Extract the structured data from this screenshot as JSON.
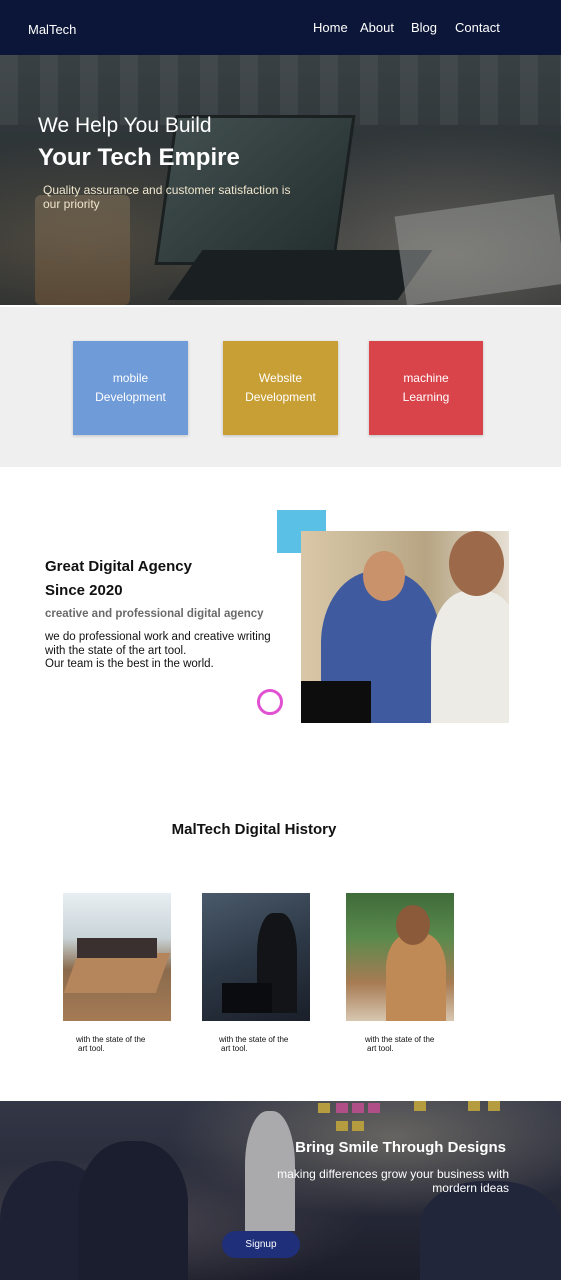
{
  "nav": {
    "brand": "MalTech",
    "links": [
      "Home",
      "About",
      "Blog",
      "Contact"
    ]
  },
  "hero": {
    "line1": "We Help You Build",
    "line2": "Your Tech Empire",
    "subtitle": "Quality assurance and customer satisfaction is our priority"
  },
  "services": [
    {
      "line1": "mobile",
      "line2": "Development",
      "color": "#6f9bd8"
    },
    {
      "line1": "Website",
      "line2": "Development",
      "color": "#c89f34"
    },
    {
      "line1": "machine",
      "line2": "Learning",
      "color": "#d9434a"
    }
  ],
  "about": {
    "title_line1": "Great Digital Agency",
    "title_line2": "Since 2020",
    "subtitle": "creative and professional digital agency",
    "body_line1": "we do professional  work and creative writing",
    "body_line2": "with the state of the art tool.",
    "body_line3": "Our team is the best in the world."
  },
  "history": {
    "title": "MalTech Digital History",
    "captions": [
      {
        "line1": "with the state of the",
        "line2": "art tool."
      },
      {
        "line1": "with the state of the",
        "line2": "art tool."
      },
      {
        "line1": "with the state of the",
        "line2": "art tool."
      }
    ]
  },
  "cta": {
    "title": "Bring Smile Through Designs",
    "subtitle_line1": "making differences grow your business with",
    "subtitle_line2": "mordern ideas",
    "button": "Signup"
  },
  "colors": {
    "nav_bg": "#0c1638",
    "accent_blue": "#5bc0e6",
    "accent_pink": "#e052d2",
    "signup_bg": "#1f2f7a"
  }
}
